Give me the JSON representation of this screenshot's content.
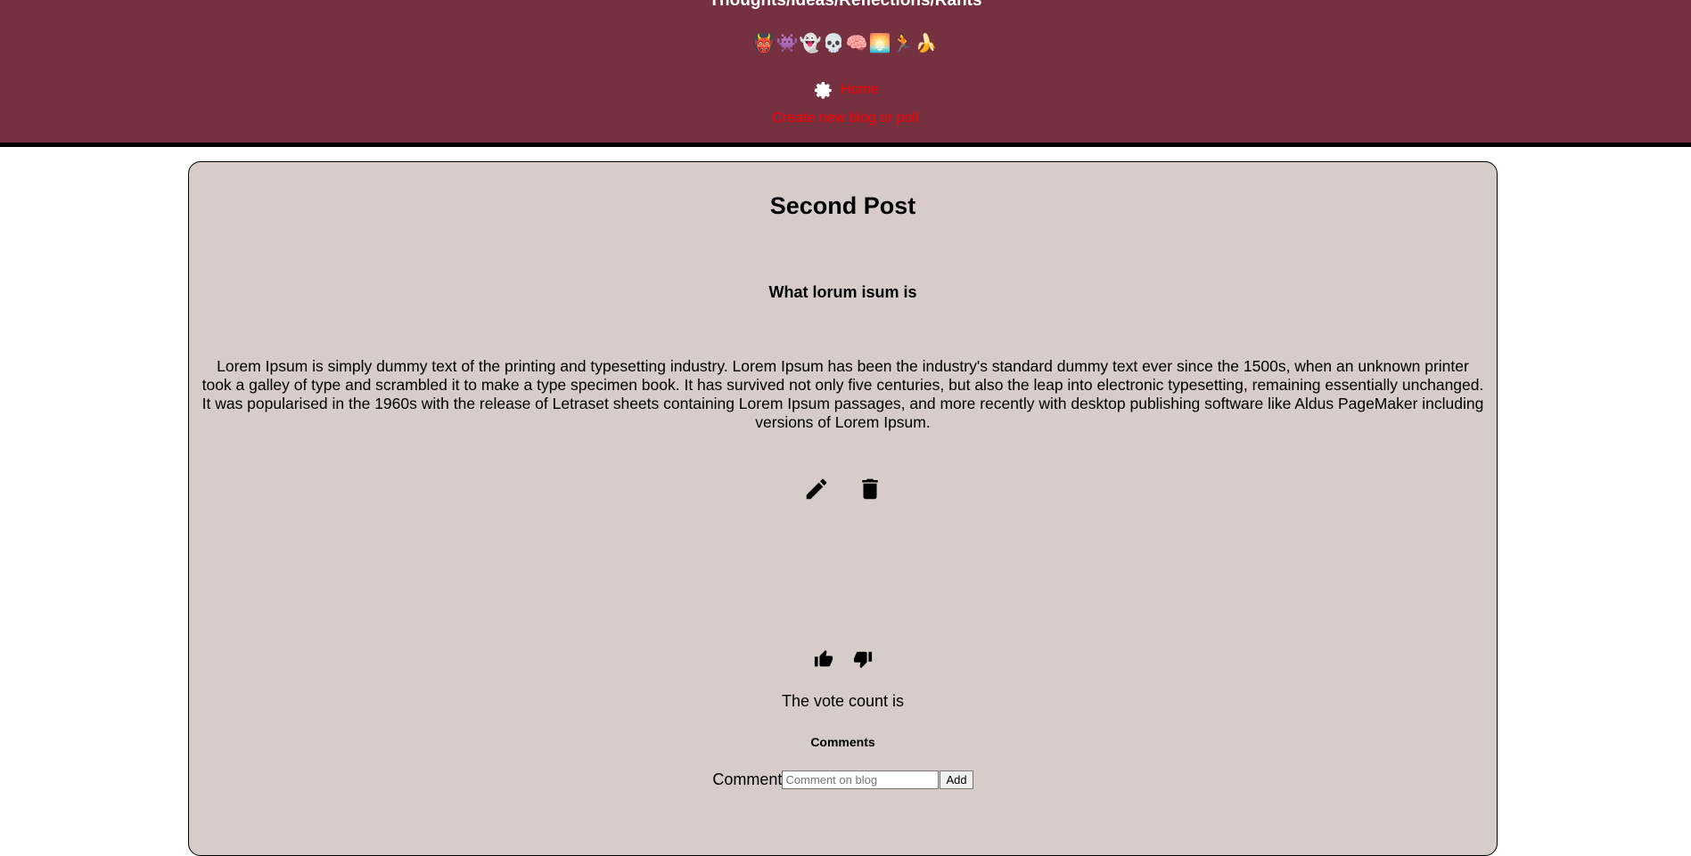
{
  "header": {
    "site_title": "Thoughts/Ideas/Reflections/Rants",
    "emojis": [
      "👹",
      "👾",
      "👻",
      "💀",
      "🧠",
      "🌅",
      "🏃",
      "🍌"
    ],
    "home_label": "Home",
    "create_label": "Create new blog or poll",
    "background_color": "#763141",
    "link_color": "#ff0000"
  },
  "post": {
    "title": "Second Post",
    "subtitle": "What lorum isum is",
    "body": "Lorem Ipsum is simply dummy text of the printing and typesetting industry. Lorem Ipsum has been the industry's standard dummy text ever since the 1500s, when an unknown printer took a galley of type and scrambled it to make a type specimen book. It has survived not only five centuries, but also the leap into electronic typesetting, remaining essentially unchanged. It was popularised in the 1960s with the release of Letraset sheets containing Lorem Ipsum passages, and more recently with desktop publishing software like Aldus PageMaker including versions of Lorem Ipsum.",
    "edit_icon": "pencil-icon",
    "delete_icon": "trash-icon",
    "card_color": "#d7ccc7"
  },
  "votes": {
    "upvote_icon": "thumbs-up-icon",
    "downvote_icon": "thumbs-down-icon",
    "count_label": "The vote count is"
  },
  "comments": {
    "heading": "Comments",
    "label": "Comment",
    "placeholder": "Comment on blog",
    "add_label": "Add"
  }
}
